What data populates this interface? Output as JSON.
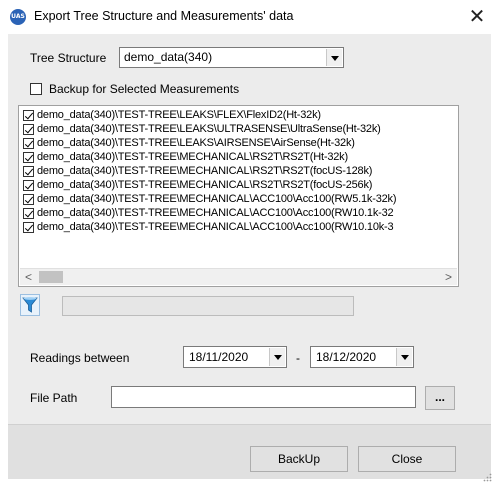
{
  "window": {
    "app_icon_text": "UAS",
    "title": "Export Tree Structure and Measurements' data",
    "close_glyph": "✕"
  },
  "tree_structure": {
    "label": "Tree Structure",
    "selected": "demo_data(340)"
  },
  "backup_option": {
    "label": "Backup for Selected Measurements",
    "checked": false
  },
  "measurements": [
    {
      "label": "demo_data(340)\\TEST-TREE\\LEAKS\\FLEX\\FlexID2(Ht-32k)",
      "checked": true
    },
    {
      "label": "demo_data(340)\\TEST-TREE\\LEAKS\\ULTRASENSE\\UltraSense(Ht-32k)",
      "checked": true
    },
    {
      "label": "demo_data(340)\\TEST-TREE\\LEAKS\\AIRSENSE\\AirSense(Ht-32k)",
      "checked": true
    },
    {
      "label": "demo_data(340)\\TEST-TREE\\MECHANICAL\\RS2T\\RS2T(Ht-32k)",
      "checked": true
    },
    {
      "label": "demo_data(340)\\TEST-TREE\\MECHANICAL\\RS2T\\RS2T(focUS-128k)",
      "checked": true
    },
    {
      "label": "demo_data(340)\\TEST-TREE\\MECHANICAL\\RS2T\\RS2T(focUS-256k)",
      "checked": true
    },
    {
      "label": "demo_data(340)\\TEST-TREE\\MECHANICAL\\ACC100\\Acc100(RW5.1k-32k)",
      "checked": true
    },
    {
      "label": "demo_data(340)\\TEST-TREE\\MECHANICAL\\ACC100\\Acc100(RW10.1k-32",
      "checked": true
    },
    {
      "label": "demo_data(340)\\TEST-TREE\\MECHANICAL\\ACC100\\Acc100(RW10.10k-3",
      "checked": true
    }
  ],
  "scroll": {
    "left_glyph": "<",
    "right_glyph": ">"
  },
  "readings": {
    "label": "Readings between",
    "from_date": "18/11/2020",
    "separator": "-",
    "to_date": "18/12/2020"
  },
  "file_path": {
    "label": "File Path",
    "value": "",
    "browse_label": "..."
  },
  "buttons": {
    "backup": "BackUp",
    "close": "Close"
  },
  "colors": {
    "client_bg": "#ececec",
    "footer_bg": "#e0e0e0",
    "filter_icon": "#2b8bd6"
  }
}
